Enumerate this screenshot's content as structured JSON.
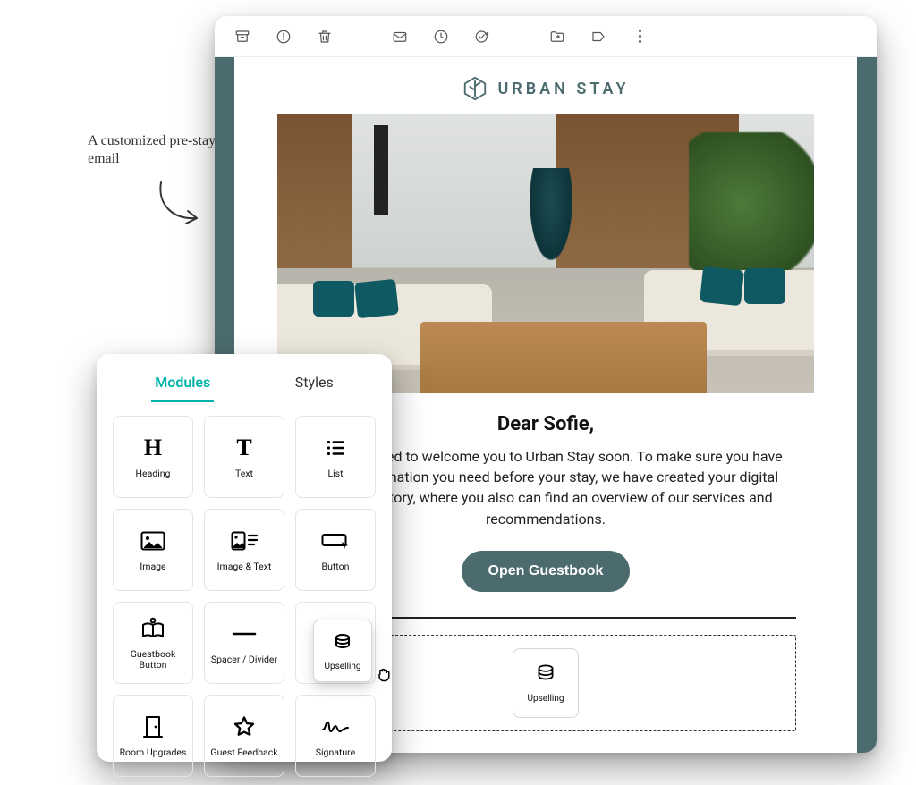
{
  "caption": "A customized pre-stay email",
  "toolbar_icons": [
    "archive",
    "spam",
    "trash",
    "snooze",
    "clock",
    "task",
    "move",
    "label",
    "more"
  ],
  "email": {
    "brand_name": "URBAN STAY",
    "greeting": "Dear Sofie,",
    "body": "We are excited to welcome you to Urban Stay soon. To make sure you have all the information you need before your stay, we have created your digital guest directory, where you also can find an overview of our services and recommendations.",
    "cta_label": "Open Guestbook",
    "dropzone_module": "Upselling"
  },
  "panel": {
    "tabs": {
      "modules": "Modules",
      "styles": "Styles"
    },
    "modules": [
      {
        "id": "heading",
        "label": "Heading",
        "icon": "H"
      },
      {
        "id": "text",
        "label": "Text",
        "icon": "T"
      },
      {
        "id": "list",
        "label": "List",
        "icon": "list"
      },
      {
        "id": "image",
        "label": "Image",
        "icon": "image"
      },
      {
        "id": "image-text",
        "label": "Image & Text",
        "icon": "imgtext"
      },
      {
        "id": "button",
        "label": "Button",
        "icon": "button"
      },
      {
        "id": "guestbook-btn",
        "label": "Guestbook Button",
        "icon": "book"
      },
      {
        "id": "spacer",
        "label": "Spacer / Divider",
        "icon": "divider"
      },
      {
        "id": "upselling",
        "label": "Upselling",
        "icon": "coins"
      },
      {
        "id": "room-upgrades",
        "label": "Room Upgrades",
        "icon": "door"
      },
      {
        "id": "guest-feedback",
        "label": "Guest Feedback",
        "icon": "star"
      },
      {
        "id": "signature",
        "label": "Signature",
        "icon": "sig"
      }
    ]
  },
  "drag_module": "Upselling"
}
